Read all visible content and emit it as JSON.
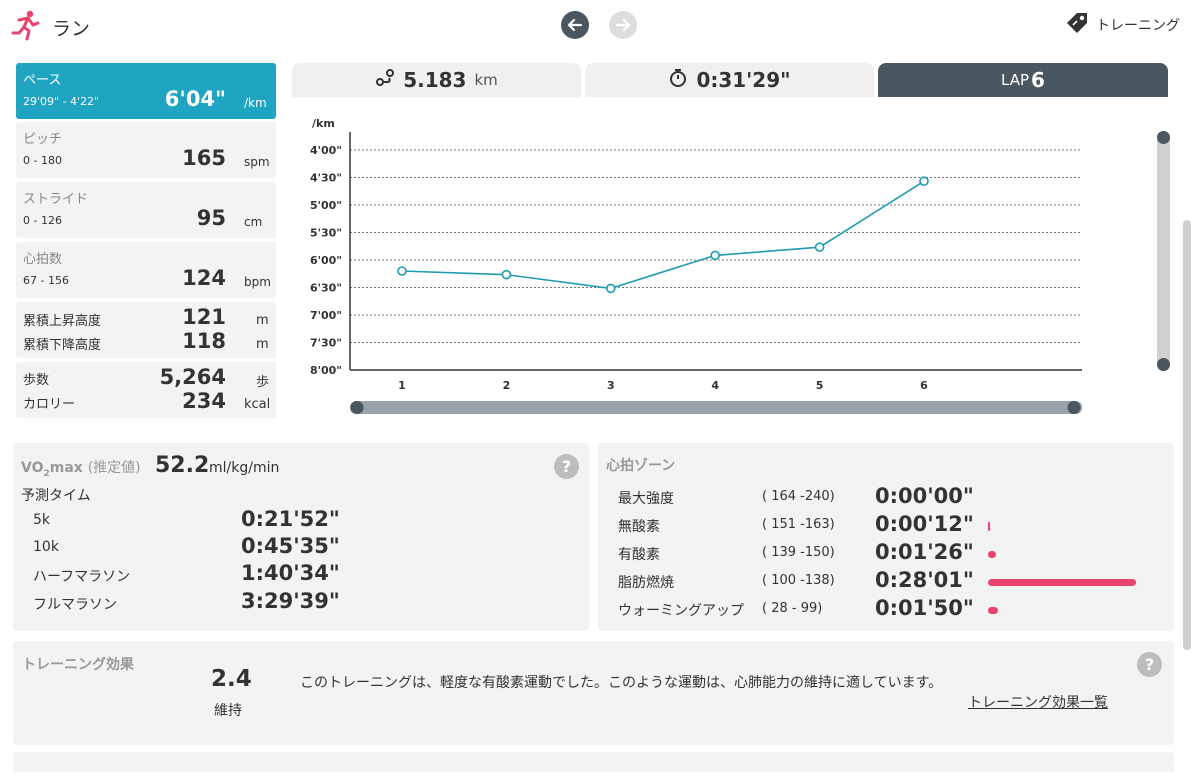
{
  "header": {
    "title": "ラン",
    "training_label": "トレーニング"
  },
  "colors": {
    "accent": "#1fa4c2",
    "dark": "#4a5660",
    "zone_bar": "#e8436d",
    "run_icon": "#e8436d"
  },
  "metrics": [
    {
      "label": "ペース",
      "range": "29'09\" - 4'22\"",
      "value": "6'04\"",
      "unit": "/km"
    },
    {
      "label": "ピッチ",
      "range": "0 - 180",
      "value": "165",
      "unit": "spm"
    },
    {
      "label": "ストライド",
      "range": "0 - 126",
      "value": "95",
      "unit": "cm"
    },
    {
      "label": "心拍数",
      "range": "67 - 156",
      "value": "124",
      "unit": "bpm"
    }
  ],
  "elevation": {
    "up_label": "累積上昇高度",
    "up_value": "121",
    "up_unit": "m",
    "down_label": "累積下降高度",
    "down_value": "118",
    "down_unit": "m"
  },
  "steps": {
    "steps_label": "歩数",
    "steps_value": "5,264",
    "steps_unit": "歩",
    "cal_label": "カロリー",
    "cal_value": "234",
    "cal_unit": "kcal"
  },
  "tabs": {
    "distance_value": "5.183",
    "distance_unit": "km",
    "time_value": "0:31'29\"",
    "lap_label": "LAP",
    "lap_value": "6"
  },
  "chart_data": {
    "type": "line",
    "ylabel": "/km",
    "y_ticks": [
      "4'00\"",
      "4'30\"",
      "5'00\"",
      "5'30\"",
      "6'00\"",
      "6'30\"",
      "7'00\"",
      "7'30\"",
      "8'00\""
    ],
    "y_tick_seconds": [
      240,
      270,
      300,
      330,
      360,
      390,
      420,
      450,
      480
    ],
    "ylim_seconds": [
      240,
      480
    ],
    "y_inverted": true,
    "categories": [
      "1",
      "2",
      "3",
      "4",
      "5",
      "6"
    ],
    "values_seconds": [
      372,
      376,
      391,
      355,
      346,
      274
    ],
    "grid": true,
    "line_color": "#1f9bb0"
  },
  "vo2": {
    "title_main": "VO",
    "title_sub": "2",
    "title_main2": "max",
    "title_note": "(推定値)",
    "value": "52.2",
    "unit": "ml/kg/min",
    "predict_label": "予測タイム",
    "predictions": [
      {
        "name": "5k",
        "time": "0:21'52\""
      },
      {
        "name": "10k",
        "time": "0:45'35\""
      },
      {
        "name": "ハーフマラソン",
        "time": "1:40'34\""
      },
      {
        "name": "フルマラソン",
        "time": "3:29'39\""
      }
    ]
  },
  "hr_zone": {
    "title": "心拍ゾーン",
    "zones": [
      {
        "name": "最大強度",
        "range": "( 164 -240)",
        "time": "0:00'00\"",
        "fraction": 0.0
      },
      {
        "name": "無酸素",
        "range": "( 151 -163)",
        "time": "0:00'12\"",
        "fraction": 0.007
      },
      {
        "name": "有酸素",
        "range": "( 139 -150)",
        "time": "0:01'26\"",
        "fraction": 0.051
      },
      {
        "name": "脂肪燃焼",
        "range": "( 100 -138)",
        "time": "0:28'01\"",
        "fraction": 1.0
      },
      {
        "name": "ウォーミングアップ",
        "range": "( 28 - 99)",
        "time": "0:01'50\"",
        "fraction": 0.065
      }
    ]
  },
  "training_effect": {
    "title": "トレーニング効果",
    "value": "2.4",
    "level": "維持",
    "description": "このトレーニングは、軽度な有酸素運動でした。このような運動は、心肺能力の維持に適しています。",
    "link": "トレーニング効果一覧"
  }
}
